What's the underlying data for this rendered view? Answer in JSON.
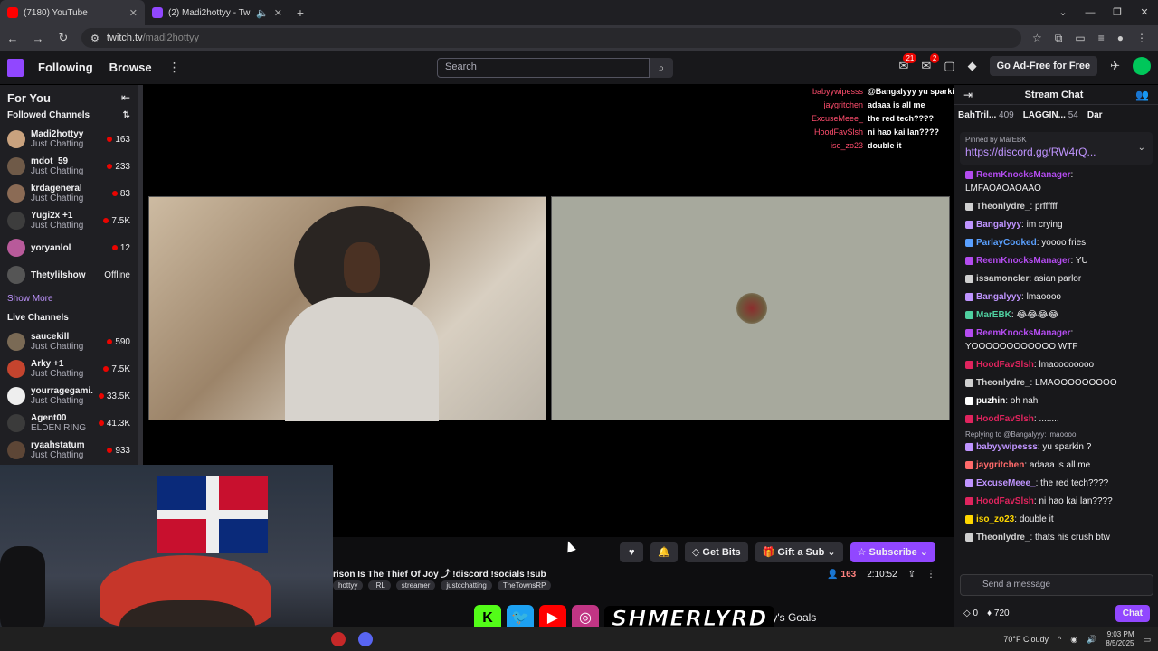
{
  "browser": {
    "tabs": [
      {
        "title": "(7180) YouTube",
        "color": "#ff0000"
      },
      {
        "title": "(2) Madi2hottyy - Twitch",
        "color": "#9147ff"
      }
    ],
    "url_host": "twitch.tv",
    "url_path": "/madi2hottyy"
  },
  "topnav": {
    "following": "Following",
    "browse": "Browse",
    "search_placeholder": "Search",
    "inbox_count": "21",
    "whispers_count": "2",
    "adfree": "Go Ad-Free for Free"
  },
  "sidebar": {
    "for_you": "For You",
    "followed_title": "Followed Channels",
    "followed": [
      {
        "name": "Madi2hottyy",
        "category": "Just Chatting",
        "viewers": "163",
        "color": "#c9a27e"
      },
      {
        "name": "mdot_59",
        "category": "Just Chatting",
        "viewers": "233",
        "color": "#6f5a48"
      },
      {
        "name": "krdageneral",
        "category": "Just Chatting",
        "viewers": "83",
        "color": "#8b6b55"
      },
      {
        "name": "Yugi2x +1",
        "category": "Just Chatting",
        "viewers": "7.5K",
        "color": "#3d3d3d"
      },
      {
        "name": "yoryanlol",
        "category": "",
        "viewers": "12",
        "color": "#b85a9a"
      },
      {
        "name": "Thetylilshow",
        "category": "",
        "viewers": "Offline",
        "color": "#555"
      }
    ],
    "show_more": "Show More",
    "live_title": "Live Channels",
    "live": [
      {
        "name": "saucekill",
        "category": "Just Chatting",
        "viewers": "590",
        "color": "#7a6a55"
      },
      {
        "name": "Arky +1",
        "category": "Just Chatting",
        "viewers": "7.5K",
        "color": "#c4442e"
      },
      {
        "name": "yourragegami...",
        "category": "Just Chatting",
        "viewers": "33.5K",
        "color": "#eee"
      },
      {
        "name": "Agent00",
        "category": "ELDEN RING",
        "viewers": "41.3K",
        "color": "#3b3b3b"
      },
      {
        "name": "ryaahstatum",
        "category": "Just Chatting",
        "viewers": "933",
        "color": "#5d4636"
      }
    ]
  },
  "overlay_chat": [
    {
      "user": "babyywipesss",
      "msg": "@Bangalyyy yu sparkin"
    },
    {
      "user": "jaygritchen",
      "msg": "adaaa is all me"
    },
    {
      "user": "ExcuseMeee_",
      "msg": "the red tech????"
    },
    {
      "user": "HoodFavSlsh",
      "msg": "ni hao kai lan????"
    },
    {
      "user": "iso_zo23",
      "msg": "double it"
    }
  ],
  "stream": {
    "title": "rison Is The Thief Of Joy ⤴ !discord !socials !sub",
    "tags": [
      "hottyy",
      "IRL",
      "streamer",
      "justcchatting",
      "TheTownsRP"
    ],
    "viewers": "163",
    "uptime": "2:10:52",
    "get_bits": "Get Bits",
    "gift_sub": "Gift a Sub",
    "subscribe": "Subscribe",
    "goals": "tyy's Goals"
  },
  "banner": {
    "name": "SHMERLYRD"
  },
  "chat": {
    "header": "Stream Chat",
    "hype": [
      {
        "name": "BahTril...",
        "count": "409"
      },
      {
        "name": "LAGGIN...",
        "count": "54"
      },
      {
        "name": "Dar",
        "count": ""
      }
    ],
    "pinned_by": "Pinned by MarEBK",
    "pinned_link": "https://discord.gg/RW4rQ...",
    "messages": [
      {
        "user": "ReemKnocksManager",
        "color": "#b44cf0",
        "text": "LMFAOAOAOAAO",
        "reply": ""
      },
      {
        "user": "Theonlydre_",
        "color": "#d0d0d0",
        "text": "prffffff",
        "reply": ""
      },
      {
        "user": "Bangalyyy",
        "color": "#bf94ff",
        "text": "im crying",
        "reply": ""
      },
      {
        "user": "ParlayCooked",
        "color": "#5aa0ff",
        "text": "yoooo fries",
        "reply": ""
      },
      {
        "user": "ReemKnocksManager",
        "color": "#b44cf0",
        "text": "YU",
        "reply": ""
      },
      {
        "user": "issamoncler",
        "color": "#d0d0d0",
        "text": "asian parlor",
        "reply": ""
      },
      {
        "user": "Bangalyyy",
        "color": "#bf94ff",
        "text": "lmaoooo",
        "reply": ""
      },
      {
        "user": "MarEBK",
        "color": "#4fd0a0",
        "text": "😂😂😂😂",
        "reply": ""
      },
      {
        "user": "ReemKnocksManager",
        "color": "#b44cf0",
        "text": "YOOOOOOOOOOOO WTF",
        "reply": ""
      },
      {
        "user": "HoodFavSlsh",
        "color": "#e0245e",
        "text": "lmaoooooooo",
        "reply": ""
      },
      {
        "user": "Theonlydre_",
        "color": "#d0d0d0",
        "text": "LMAOOOOOOOOO",
        "reply": ""
      },
      {
        "user": "puzhin",
        "color": "#ffffff",
        "text": "oh nah",
        "reply": ""
      },
      {
        "user": "HoodFavSlsh",
        "color": "#e0245e",
        "text": "........",
        "reply": ""
      },
      {
        "user": "babyywipesss",
        "color": "#bf94ff",
        "text": "yu sparkin ?",
        "reply": "Replying to @Bangalyyy: lmaoooo"
      },
      {
        "user": "jaygritchen",
        "color": "#ff6a6a",
        "text": "adaaa is all me",
        "reply": ""
      },
      {
        "user": "ExcuseMeee_",
        "color": "#bf94ff",
        "text": "the red tech????",
        "reply": ""
      },
      {
        "user": "HoodFavSlsh",
        "color": "#e0245e",
        "text": "ni hao kai lan????",
        "reply": ""
      },
      {
        "user": "iso_zo23",
        "color": "#ffd700",
        "text": "double it",
        "reply": ""
      },
      {
        "user": "Theonlydre_",
        "color": "#d0d0d0",
        "text": "thats his crush btw",
        "reply": ""
      }
    ],
    "input_placeholder": "Send a message",
    "points": "0",
    "bits": "720",
    "chat_button": "Chat"
  },
  "taskbar": {
    "weather": "70°F  Cloudy",
    "time": "9:03 PM",
    "date": "8/5/2025"
  }
}
